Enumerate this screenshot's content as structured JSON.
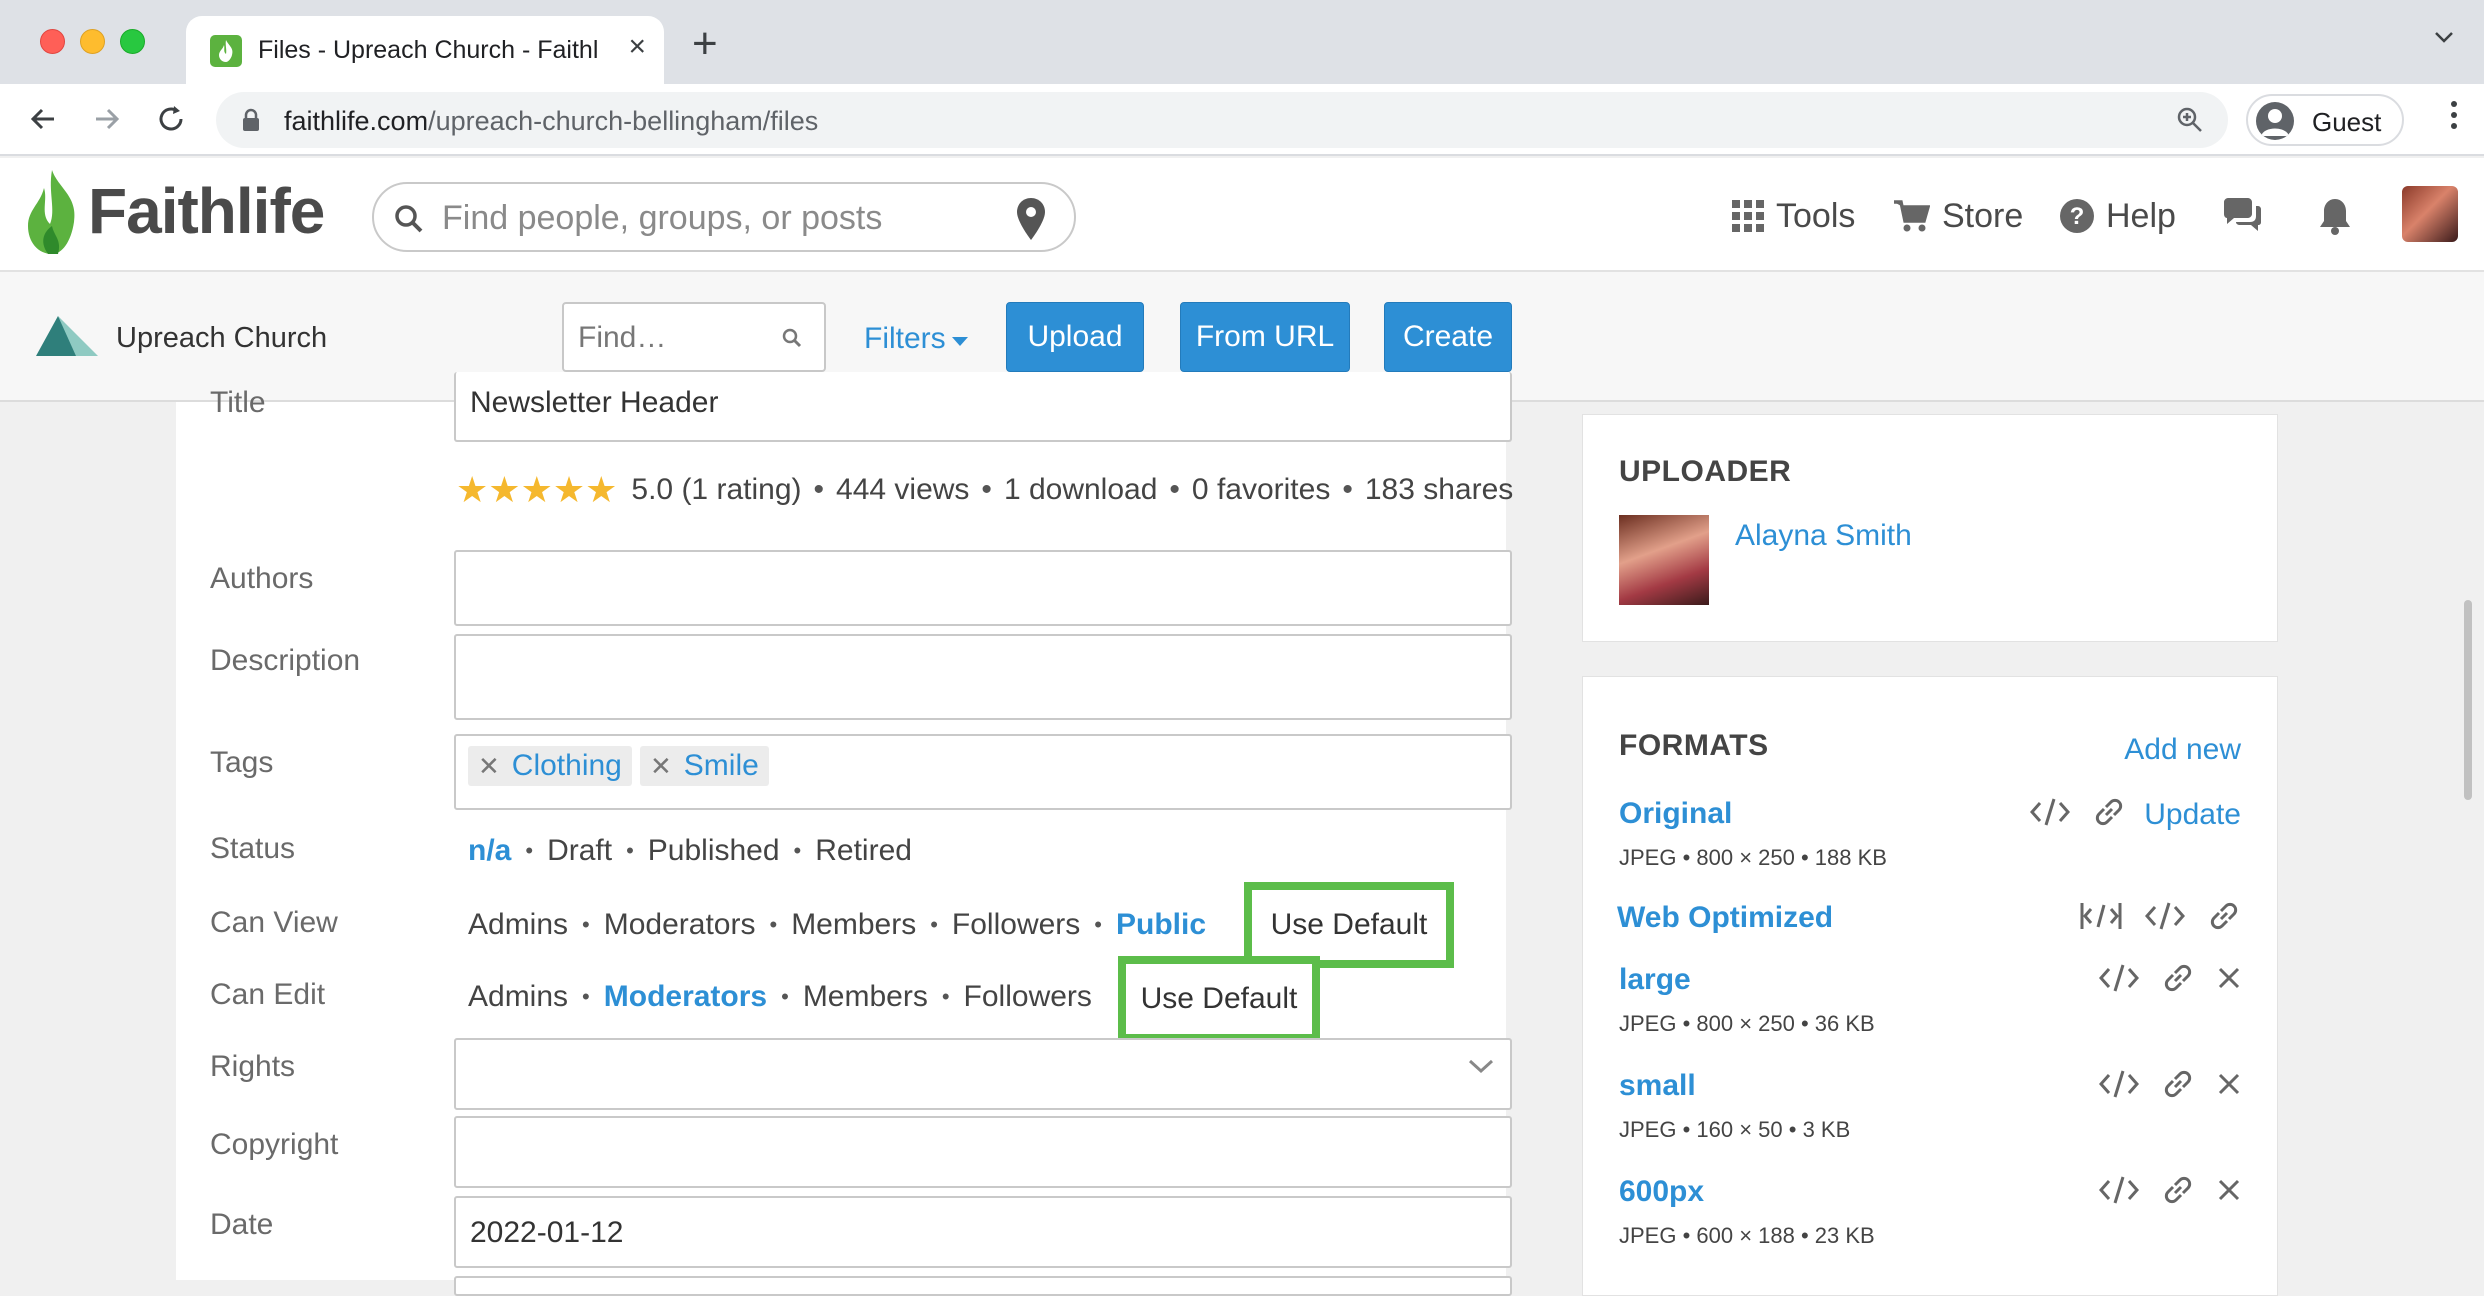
{
  "browser": {
    "tab_title": "Files - Upreach Church - Faithlife",
    "url_host": "faithlife.com",
    "url_path": "/upreach-church-bellingham/files",
    "profile_label": "Guest"
  },
  "header": {
    "logo_text": "Faithlife",
    "search_placeholder": "Find people, groups, or posts",
    "tools_label": "Tools",
    "store_label": "Store",
    "help_label": "Help"
  },
  "subbar": {
    "group_name": "Upreach Church",
    "find_placeholder": "Find…",
    "filters_label": "Filters",
    "upload_label": "Upload",
    "from_url_label": "From URL",
    "create_label": "Create"
  },
  "form": {
    "title_label": "Title",
    "title_value": "Newsletter Header",
    "rating": {
      "stars": 5,
      "rating_text": "5.0 (1 rating)",
      "views": "444 views",
      "downloads": "1 download",
      "favorites": "0 favorites",
      "shares": "183 shares"
    },
    "authors_label": "Authors",
    "description_label": "Description",
    "tags_label": "Tags",
    "tags": [
      "Clothing",
      "Smile"
    ],
    "status_label": "Status",
    "status_options": [
      "n/a",
      "Draft",
      "Published",
      "Retired"
    ],
    "status_selected": "n/a",
    "can_view_label": "Can View",
    "can_view_options": [
      "Admins",
      "Moderators",
      "Members",
      "Followers",
      "Public"
    ],
    "can_view_selected": "Public",
    "can_view_default": "Use Default",
    "can_edit_label": "Can Edit",
    "can_edit_options": [
      "Admins",
      "Moderators",
      "Members",
      "Followers"
    ],
    "can_edit_selected": "Moderators",
    "can_edit_default": "Use Default",
    "rights_label": "Rights",
    "copyright_label": "Copyright",
    "date_label": "Date",
    "date_value": "2022-01-12"
  },
  "uploader": {
    "heading": "UPLOADER",
    "name": "Alayna Smith"
  },
  "formats": {
    "heading": "FORMATS",
    "add_new": "Add new",
    "update_label": "Update",
    "items": [
      {
        "name": "Original",
        "meta": "JPEG • 800 × 250 • 188 KB"
      },
      {
        "name": "Web Optimized",
        "meta": ""
      },
      {
        "name": "large",
        "meta": "JPEG • 800 × 250 • 36 KB"
      },
      {
        "name": "small",
        "meta": "JPEG • 160 × 50 • 3 KB"
      },
      {
        "name": "600px",
        "meta": "JPEG • 600 × 188 • 23 KB"
      }
    ]
  },
  "colors": {
    "accent": "#2d8fd5",
    "highlight": "#5cbd4a",
    "brand_green": "#5cb23f"
  }
}
